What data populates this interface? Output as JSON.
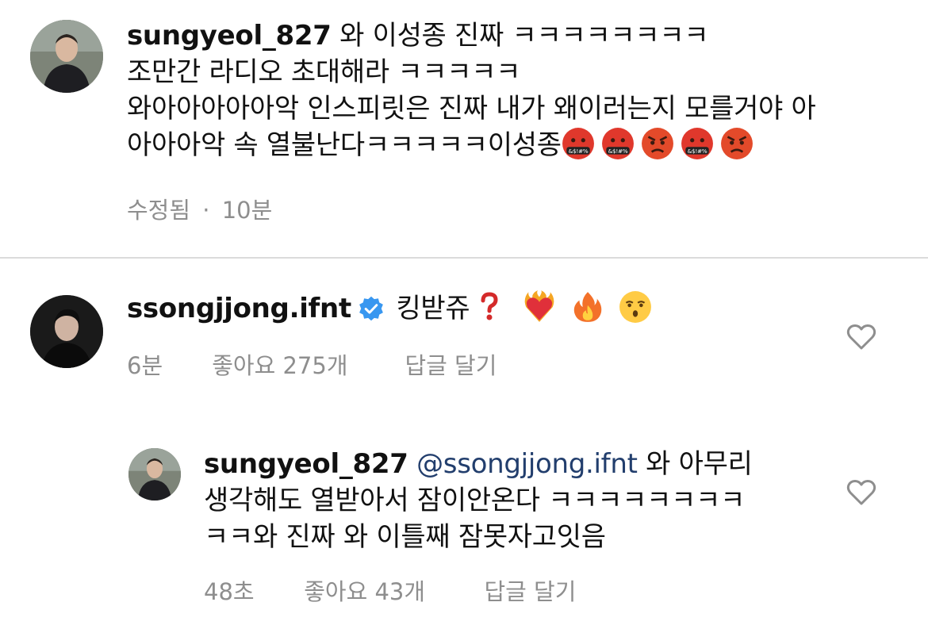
{
  "comment1": {
    "username": "sungyeol_827",
    "text_line1": "와 이성종 진짜 ㅋㅋㅋㅋㅋㅋㅋㅋ",
    "text_line2": "조만간 라디오 초대해라 ㅋㅋㅋㅋㅋ",
    "text_line3": "와아아아아아악 인스피릿은 진짜 내가 왜이러는지 모를거야 아",
    "text_line4": "아아아악 속 열불난다ㅋㅋㅋㅋㅋ이성종",
    "emojis": [
      "cursing-face-emoji",
      "cursing-face-emoji",
      "angry-face-emoji",
      "cursing-face-emoji",
      "angry-face-emoji"
    ],
    "edited_label": "수정됨",
    "separator": "·",
    "time": "10분"
  },
  "comment2": {
    "username": "ssongjjong.ifnt",
    "text": "킹받쥬",
    "emojis": [
      "question-mark-emoji",
      "heart-on-fire-emoji",
      "fire-emoji",
      "kissing-face-emoji"
    ],
    "time": "6분",
    "likes": "좋아요 275개",
    "reply_label": "답글 달기"
  },
  "reply1": {
    "username": "sungyeol_827",
    "mention": "@ssongjjong.ifnt",
    "text_line1": "와 아무리",
    "text_line2": "생각해도 열받아서 잠이안온다 ㅋㅋㅋㅋㅋㅋㅋㅋ",
    "text_line3": "ㅋㅋ와 진짜 와 이틀째 잠못자고잇음",
    "time": "48초",
    "likes": "좋아요 43개",
    "reply_label": "답글 달기"
  },
  "colors": {
    "text": "#111111",
    "meta": "#8e8e8e",
    "mention": "#223e6d",
    "verified": "#3897f0",
    "divider": "#dbdbdb"
  }
}
